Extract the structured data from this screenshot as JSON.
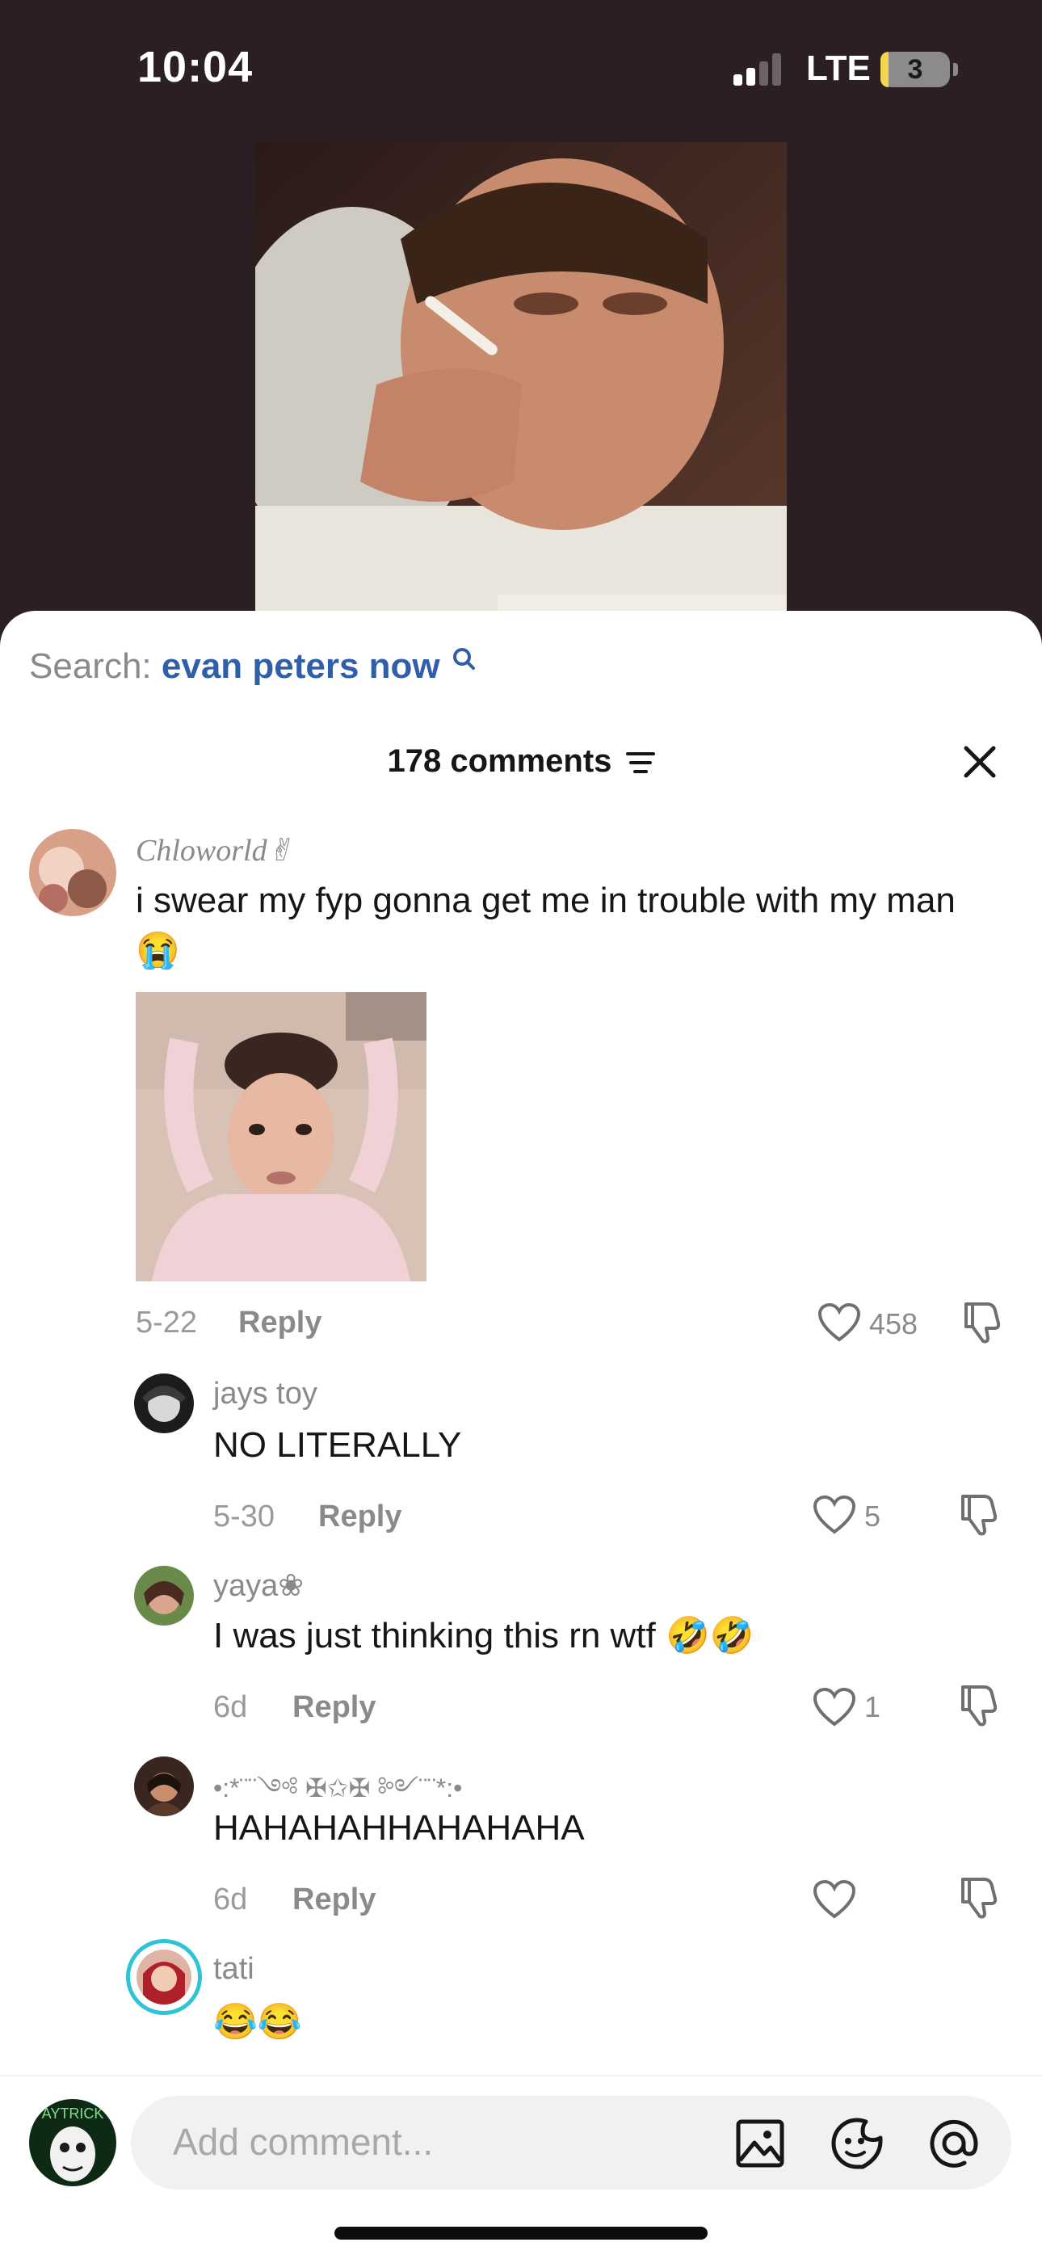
{
  "status_bar": {
    "time": "10:04",
    "network": "LTE",
    "battery": "3"
  },
  "search": {
    "label": "Search:",
    "query": "evan peters now"
  },
  "comments_header": {
    "title": "178 comments",
    "sort_icon": "filter-lines-icon",
    "close_icon": "close-icon"
  },
  "comments": [
    {
      "username": "Chloworld✌︎",
      "text": "i swear my fyp gonna get me in trouble with my man 😭",
      "date": "5-22",
      "reply_label": "Reply",
      "likes": "458"
    },
    {
      "username": "jays toy",
      "text": "NO LITERALLY",
      "date": "5-30",
      "reply_label": "Reply",
      "likes": "5"
    },
    {
      "username": "yaya❀",
      "text": "I was just thinking this rn wtf 🤣🤣",
      "date": "6d",
      "reply_label": "Reply",
      "likes": "1"
    },
    {
      "username": "•:*¨¨༺ ✠✩✠ ༻¨¨*:•",
      "text": "HAHAHAHHAHAHAHA",
      "date": "6d",
      "reply_label": "Reply",
      "likes": ""
    },
    {
      "username": "tati",
      "text": "😂😂"
    }
  ],
  "composer": {
    "placeholder": "Add comment...",
    "avatar_text": "AYTRICK"
  },
  "colors": {
    "accent_link": "#2f5fa8",
    "sheet_bg": "#ffffff",
    "top_bg": "#2b1f24",
    "story_ring": "#2fc3d6"
  }
}
